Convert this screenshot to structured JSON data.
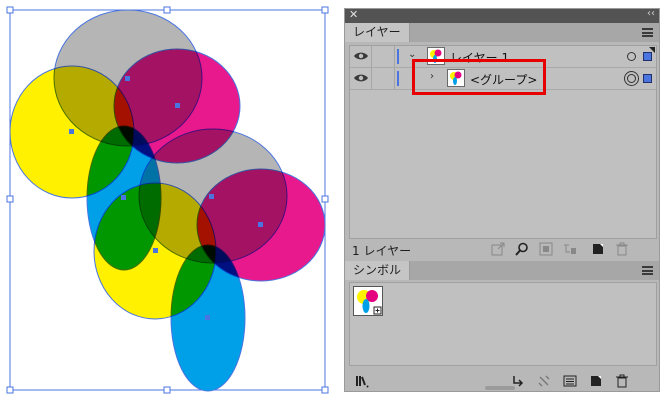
{
  "window": {
    "close_glyph": "✕",
    "collapse_glyph": "‹‹"
  },
  "layers_panel": {
    "tab_label": "レイヤー",
    "rows": [
      {
        "name": "レイヤー 1",
        "expanded": true,
        "visible": true
      },
      {
        "name": "<グループ>",
        "expanded": false,
        "visible": true
      }
    ],
    "layer_count_label": "1 レイヤー",
    "expand_glyph": "⌄",
    "collapse_glyph": "›"
  },
  "symbols_panel": {
    "tab_label": "シンボル"
  },
  "colors": {
    "cyan": "#00a0e9",
    "magenta": "#e4007f",
    "yellow": "#fff100",
    "gray": "#b5b5b5",
    "selection_blue": "#4a74e0",
    "highlight_red": "#e60000"
  }
}
